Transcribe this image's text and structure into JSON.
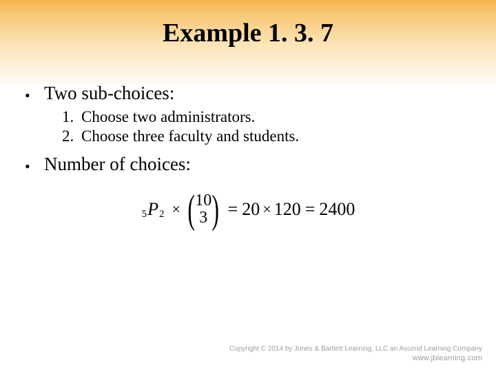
{
  "title": "Example 1. 3. 7",
  "bullet_two_sub": "Two sub-choices:",
  "numbered": {
    "n1_num": "1.",
    "n1_text": "Choose two administrators.",
    "n2_num": "2.",
    "n2_text": "Choose three faculty and students."
  },
  "bullet_num_choices": "Number of choices:",
  "formula": {
    "perm_left_sub": "5",
    "perm_letter": "P",
    "perm_right_sub": "2",
    "times1": "×",
    "binom_top": "10",
    "binom_bottom": "3",
    "eq1": "=",
    "val1": "20",
    "times2": "×",
    "val2": "120",
    "eq2": "=",
    "result": "2400"
  },
  "footer": {
    "copyright": "Copyright © 2014 by Jones & Bartlett Learning, LLC an Ascend Learning Company",
    "url": "www.jblearning.com"
  }
}
